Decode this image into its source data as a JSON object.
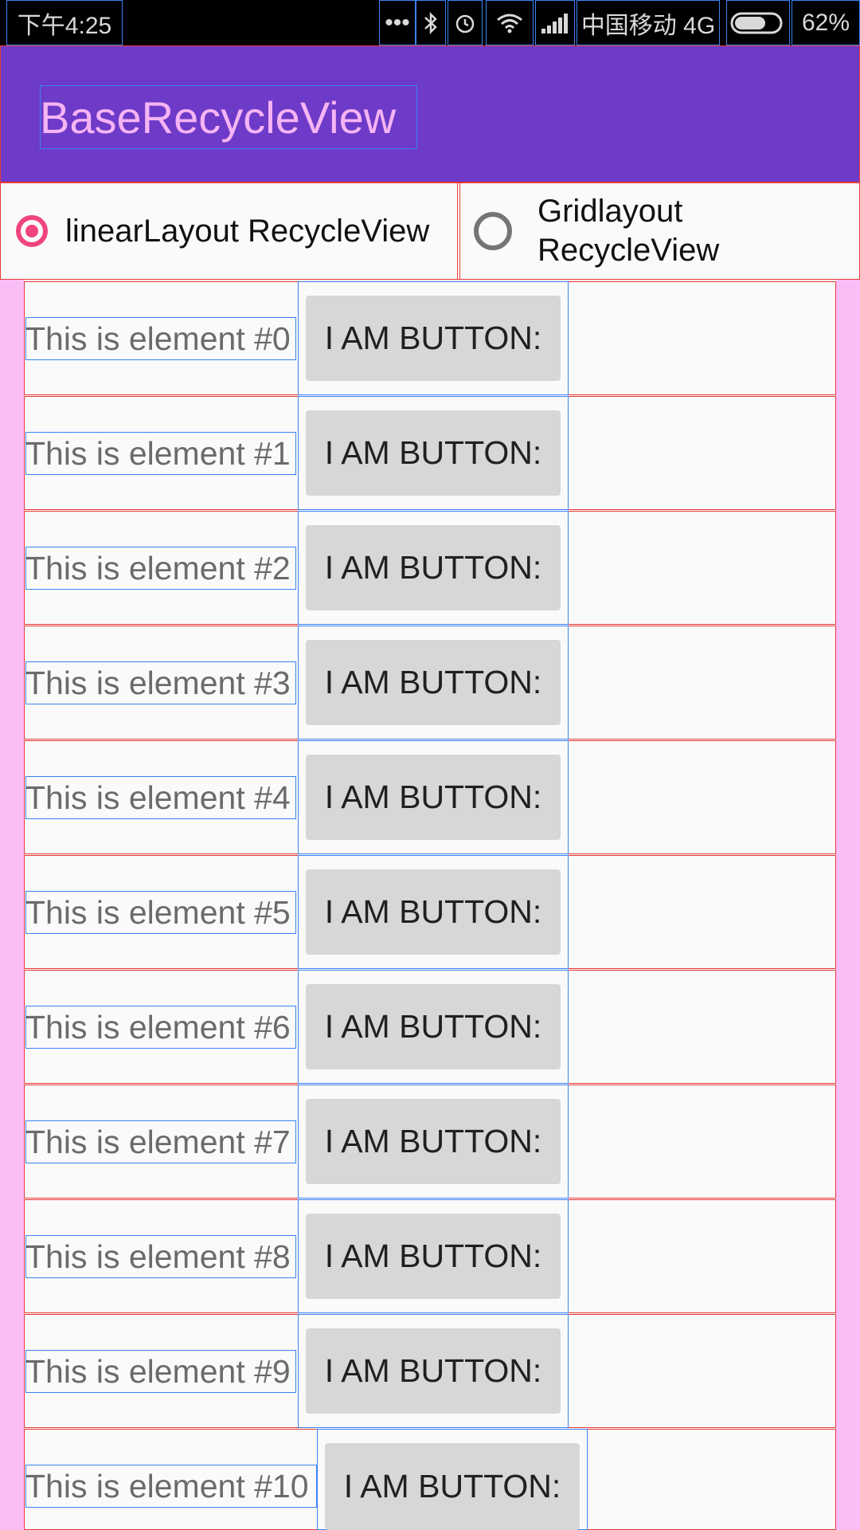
{
  "status_bar": {
    "time": "下午4:25",
    "dots": "•••",
    "carrier": "中国移动 4G",
    "battery_percent": "62%",
    "icons": [
      "bluetooth-icon",
      "alarm-icon",
      "wifi-icon",
      "signal-icon",
      "battery-icon"
    ]
  },
  "app_bar": {
    "title": "BaseRecycleView",
    "color": "#6E3AC8",
    "title_color": "#F5B4F3"
  },
  "layout_options": {
    "linear": {
      "label": "linearLayout RecycleView",
      "checked": true
    },
    "grid": {
      "label_line1": "Gridlayout",
      "label_line2": "RecycleView",
      "checked": false
    },
    "accent_color": "#F0447F"
  },
  "items": [
    {
      "label": "This is element #0",
      "button": "I AM BUTTON:"
    },
    {
      "label": "This is element #1",
      "button": "I AM BUTTON:"
    },
    {
      "label": "This is element #2",
      "button": "I AM BUTTON:"
    },
    {
      "label": "This is element #3",
      "button": "I AM BUTTON:"
    },
    {
      "label": "This is element #4",
      "button": "I AM BUTTON:"
    },
    {
      "label": "This is element #5",
      "button": "I AM BUTTON:"
    },
    {
      "label": "This is element #6",
      "button": "I AM BUTTON:"
    },
    {
      "label": "This is element #7",
      "button": "I AM BUTTON:"
    },
    {
      "label": "This is element #8",
      "button": "I AM BUTTON:"
    },
    {
      "label": "This is element #9",
      "button": "I AM BUTTON:"
    },
    {
      "label": "This is element #10",
      "button": "I AM BUTTON:"
    }
  ]
}
